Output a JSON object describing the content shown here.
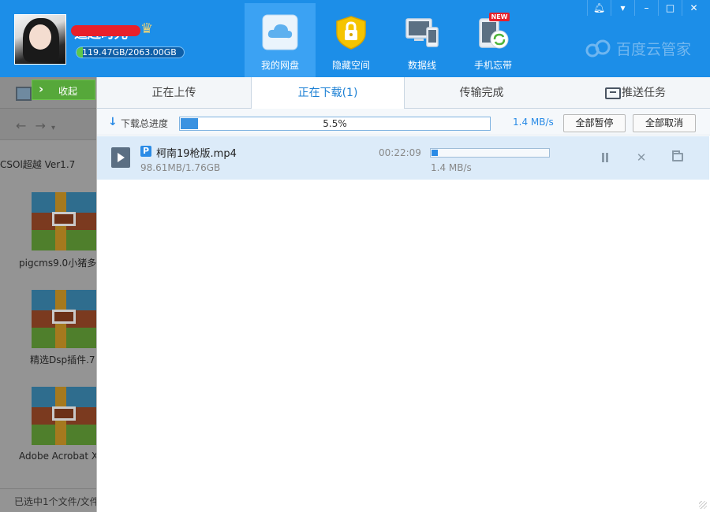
{
  "user": {
    "name": "追赶时光",
    "quota": "119.47GB/2063.00GB"
  },
  "nav": [
    {
      "label": "我的网盘",
      "icon": "cloud-icon",
      "active": true
    },
    {
      "label": "隐藏空间",
      "icon": "lock-icon",
      "active": false
    },
    {
      "label": "数据线",
      "icon": "devices-icon",
      "active": false
    },
    {
      "label": "手机忘带",
      "icon": "phone-sync-icon",
      "active": false,
      "badge": "NEW"
    }
  ],
  "brand": "百度云管家",
  "window_controls": [
    "bell-icon",
    "menu-icon",
    "minimize-icon",
    "maximize-icon",
    "close-icon"
  ],
  "sidebar": {
    "collapse_label": "收起",
    "files": [
      {
        "name": "CSOl超越 Ver1.7"
      },
      {
        "name": "pigcms9.0小猪多"
      },
      {
        "name": "精选Dsp插件.7"
      },
      {
        "name": "Adobe Acrobat X"
      }
    ],
    "status": "已选中1个文件/文件"
  },
  "transfer": {
    "tabs": [
      {
        "label": "正在上传",
        "active": false
      },
      {
        "label": "正在下载(1)",
        "active": true
      },
      {
        "label": "传输完成",
        "active": false
      },
      {
        "label": "推送任务",
        "active": false
      }
    ],
    "total_label": "下载总进度",
    "total_progress": 0.055,
    "total_percent_text": "5.5%",
    "total_speed": "1.4 MB/s",
    "pause_all": "全部暂停",
    "cancel_all": "全部取消",
    "tasks": [
      {
        "file_badge": "P",
        "file_name": "柯南19枪版.mp4",
        "size_text": "98.61MB/1.76GB",
        "eta": "00:22:09",
        "progress": 0.055,
        "speed": "1.4 MB/s"
      }
    ]
  }
}
